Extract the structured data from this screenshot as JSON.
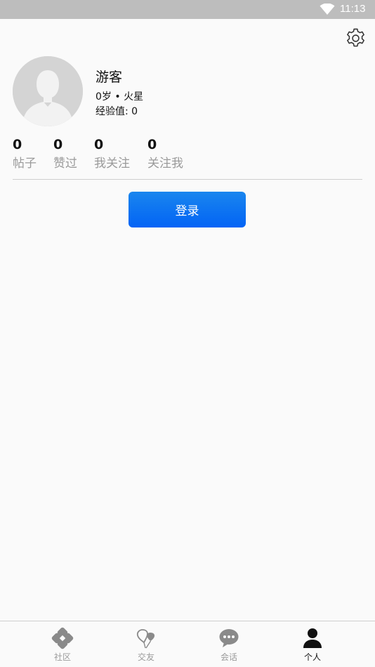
{
  "status_bar": {
    "time": "11:13"
  },
  "profile": {
    "nickname": "游客",
    "age_location": "0岁 • 火星",
    "experience": "经验值: 0"
  },
  "stats": [
    {
      "value": "0",
      "label": "帖子"
    },
    {
      "value": "0",
      "label": "赞过"
    },
    {
      "value": "0",
      "label": "我关注"
    },
    {
      "value": "0",
      "label": "关注我"
    }
  ],
  "login_button": {
    "label": "登录",
    "color_top": "#1a86ee",
    "color_bottom": "#0263f5"
  },
  "tabs": [
    {
      "label": "社区",
      "icon": "community-icon",
      "active": false
    },
    {
      "label": "交友",
      "icon": "balloons-icon",
      "active": false
    },
    {
      "label": "会话",
      "icon": "chat-bubble-icon",
      "active": false
    },
    {
      "label": "个人",
      "icon": "person-icon",
      "active": true
    }
  ]
}
